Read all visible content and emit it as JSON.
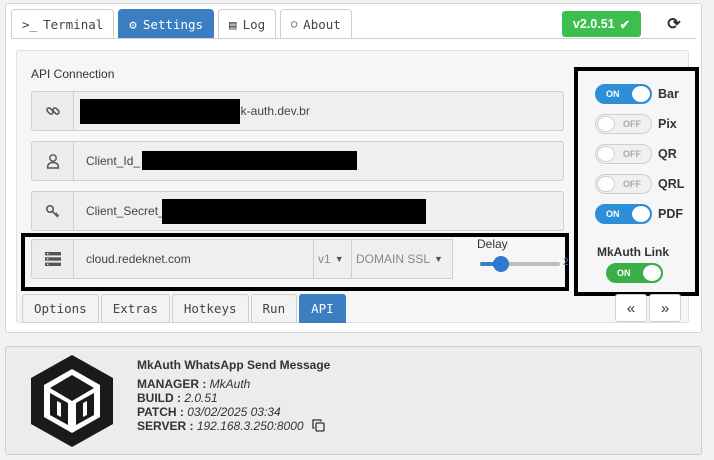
{
  "tabs": [
    {
      "icon": "terminal-icon",
      "glyph": ">_",
      "label": "Terminal"
    },
    {
      "icon": "gears-icon",
      "glyph": "⚙",
      "label": "Settings"
    },
    {
      "icon": "log-icon",
      "glyph": "▤",
      "label": "Log"
    },
    {
      "icon": "comment-icon",
      "glyph": "◯",
      "label": "About"
    }
  ],
  "active_tab": "Settings",
  "version": {
    "label": "v2.0.51",
    "color": "#3cbf4f"
  },
  "api_connection": {
    "title": "API Connection",
    "url_suffix": "nk-auth.dev.br",
    "client_id": "Client_Id_",
    "client_secret": "Client_Secret_",
    "server": "cloud.redeknet.com",
    "version_select": "v1",
    "ssl_select": "DOMAIN SSL",
    "delay_label": "Delay",
    "delay_value": "2",
    "delay_fraction": 0.2
  },
  "toggles": [
    {
      "label": "Bar",
      "state": "ON"
    },
    {
      "label": "Pix",
      "state": "OFF"
    },
    {
      "label": "QR",
      "state": "OFF"
    },
    {
      "label": "QRL",
      "state": "OFF"
    },
    {
      "label": "PDF",
      "state": "ON"
    }
  ],
  "mkauth_link": {
    "title": "MkAuth Link",
    "state": "ON"
  },
  "subtabs": [
    "Options",
    "Extras",
    "Hotkeys",
    "Run",
    "API"
  ],
  "active_subtab": "API",
  "pager": {
    "prev": "«",
    "next": "»"
  },
  "about": {
    "title": "MkAuth WhatsApp Send Message",
    "manager_label": "MANAGER :",
    "manager_value": "MkAuth",
    "build_label": "BUILD :",
    "build_value": "2.0.51",
    "patch_label": "PATCH :",
    "patch_value": "03/02/2025 03:34",
    "server_label": "SERVER :",
    "server_value": "192.168.3.250:8000"
  },
  "colors": {
    "primary": "#3b7ec1",
    "success": "#3cbf4f",
    "toggle_on": "#2c8fd8"
  }
}
